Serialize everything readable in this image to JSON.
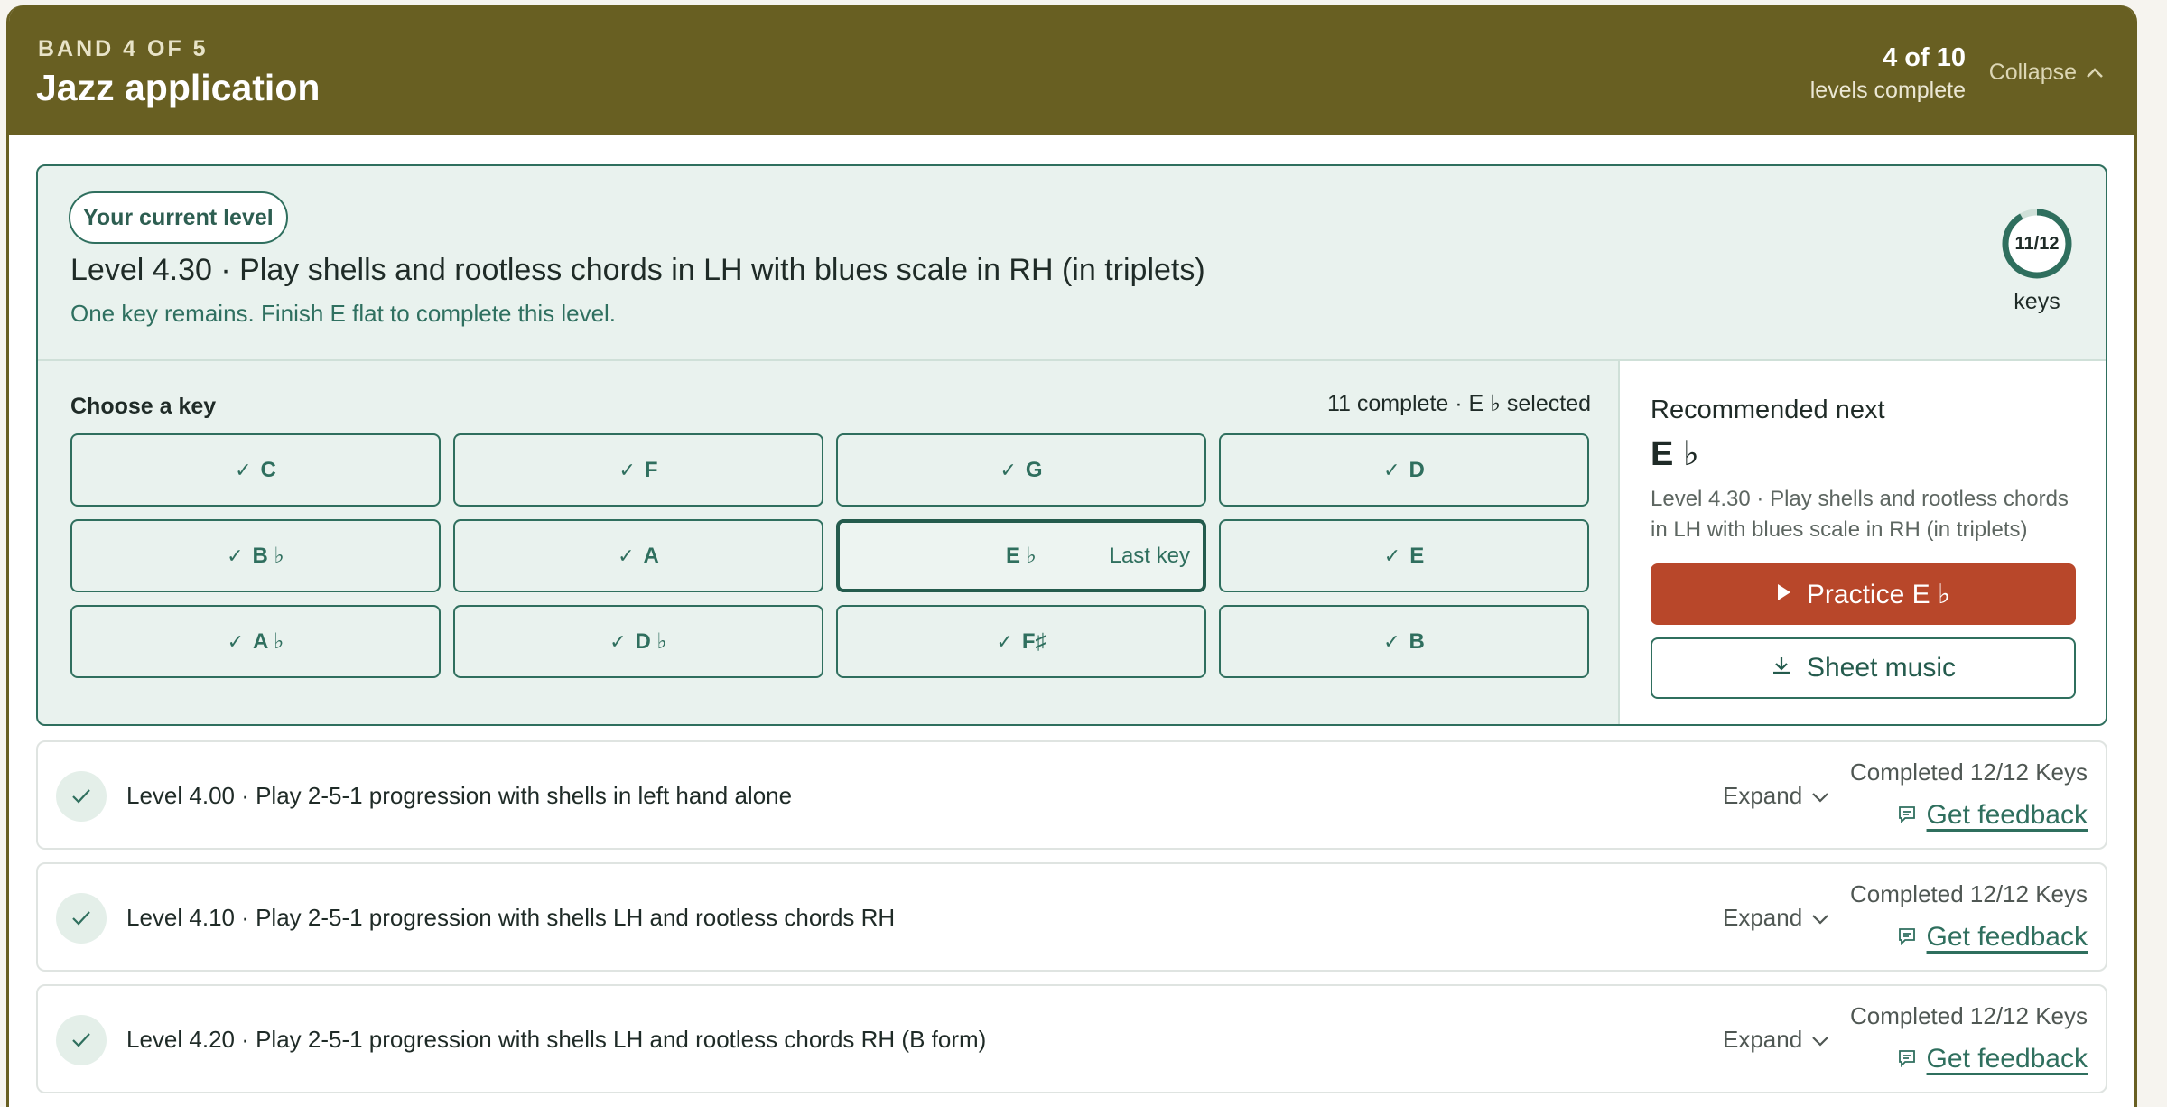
{
  "band": {
    "eyebrow": "BAND 4 OF 5",
    "title": "Jazz application",
    "progress_count": "4 of 10",
    "progress_label": "levels complete",
    "collapse_label": "Collapse"
  },
  "current_level": {
    "pill": "Your current level",
    "title": "Level 4.30 · Play shells and rootless chords in LH with blues scale in RH (in triplets)",
    "hint": "One key remains. Finish E flat to complete this level.",
    "ring_text": "11/12",
    "ring_label": "keys",
    "keys_done": 11,
    "keys_total": 12,
    "choose_label": "Choose a key",
    "choose_status": "11 complete · E ♭ selected",
    "keys": [
      {
        "label": "C",
        "status": "complete"
      },
      {
        "label": "F",
        "status": "complete"
      },
      {
        "label": "G",
        "status": "complete"
      },
      {
        "label": "D",
        "status": "complete"
      },
      {
        "label": "B ♭",
        "status": "complete"
      },
      {
        "label": "A",
        "status": "complete"
      },
      {
        "label": "E ♭",
        "status": "selected",
        "tag": "Last key"
      },
      {
        "label": "E",
        "status": "complete"
      },
      {
        "label": "A ♭",
        "status": "complete"
      },
      {
        "label": "D ♭",
        "status": "complete"
      },
      {
        "label": "F♯",
        "status": "complete"
      },
      {
        "label": "B",
        "status": "complete"
      }
    ],
    "recommended": {
      "label": "Recommended next",
      "key": "E ♭",
      "description": "Level 4.30 · Play shells and rootless chords in LH with blues scale in RH (in triplets)",
      "practice_label": "Practice E ♭",
      "sheet_label": "Sheet music"
    }
  },
  "completed_levels": [
    {
      "title": "Level 4.00 · Play 2-5-1 progression with shells in left hand alone",
      "expand": "Expand",
      "status": "Completed 12/12 Keys",
      "feedback": "Get feedback"
    },
    {
      "title": "Level 4.10 · Play 2-5-1 progression with shells LH and rootless chords RH",
      "expand": "Expand",
      "status": "Completed 12/12 Keys",
      "feedback": "Get feedback"
    },
    {
      "title": "Level 4.20 · Play 2-5-1 progression with shells LH and rootless chords RH (B form)",
      "expand": "Expand",
      "status": "Completed 12/12 Keys",
      "feedback": "Get feedback"
    }
  ],
  "colors": {
    "band_header": "#685f22",
    "accent_green": "#2f6f5e",
    "current_bg": "#e9f2ee",
    "practice_button": "#b8472a"
  },
  "icons": [
    "chevron-up-icon",
    "check-icon",
    "play-icon",
    "download-icon",
    "chevron-down-icon",
    "comment-icon"
  ]
}
